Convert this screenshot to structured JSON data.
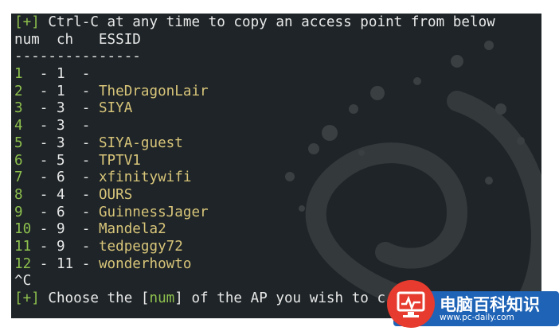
{
  "terminal": {
    "header": {
      "open_bracket": "[",
      "plus": "+",
      "close_bracket": "]",
      "message": " Ctrl-C at any time to copy an access point from below"
    },
    "columns": "num  ch   ESSID",
    "separator": "---------------",
    "rows": [
      {
        "num": "1",
        "ch": "1",
        "essid": ""
      },
      {
        "num": "2",
        "ch": "1",
        "essid": "TheDragonLair"
      },
      {
        "num": "3",
        "ch": "3",
        "essid": "SIYA"
      },
      {
        "num": "4",
        "ch": "3",
        "essid": ""
      },
      {
        "num": "5",
        "ch": "3",
        "essid": "SIYA-guest"
      },
      {
        "num": "6",
        "ch": "5",
        "essid": "TPTV1"
      },
      {
        "num": "7",
        "ch": "6",
        "essid": "xfinitywifi"
      },
      {
        "num": "8",
        "ch": "4",
        "essid": "OURS"
      },
      {
        "num": "9",
        "ch": "6",
        "essid": "GuinnessJager"
      },
      {
        "num": "10",
        "ch": "9",
        "essid": "Mandela2"
      },
      {
        "num": "11",
        "ch": "9",
        "essid": "tedpeggy72"
      },
      {
        "num": "12",
        "ch": "11",
        "essid": "wonderhowto"
      }
    ],
    "interrupt": "^C",
    "prompt": {
      "open_bracket": "[",
      "plus": "+",
      "close_bracket": "]",
      "text_before": " Choose the ",
      "open_num_bracket": "[",
      "num_word": "num",
      "close_num_bracket": "]",
      "text_after": " of the AP you wish to c"
    }
  },
  "watermark": {
    "title": "电脑百科知识",
    "url": "www.pc-daily.com",
    "icon": "monitor-icon"
  },
  "colors": {
    "terminal_bg": "#1e2427",
    "text": "#e8e8e8",
    "green": "#8ec04e",
    "essid": "#d8c57a",
    "watermark_blue": "#1e63b6",
    "watermark_red": "#e63b2e"
  }
}
